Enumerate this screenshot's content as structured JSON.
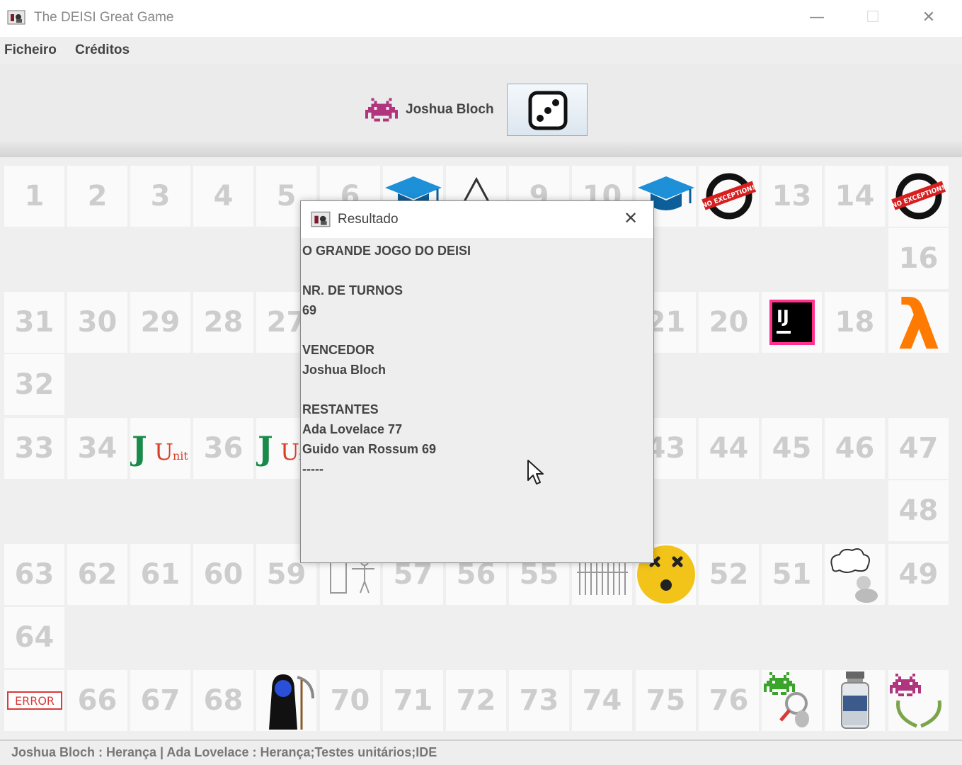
{
  "window": {
    "title": "The DEISI Great Game",
    "minimize_glyph": "—",
    "maximize_glyph": "☐",
    "close_glyph": "✕"
  },
  "menu": {
    "items": [
      "Ficheiro",
      "Créditos"
    ]
  },
  "current_player": {
    "name": "Joshua Bloch",
    "icon": "purple-space-invader-icon"
  },
  "dice_button": {
    "icon": "dice-icon",
    "face_value": 3
  },
  "board": {
    "cells": [
      {
        "num": "1"
      },
      {
        "num": "2"
      },
      {
        "num": "3"
      },
      {
        "num": "4"
      },
      {
        "num": "5"
      },
      {
        "num": "6"
      },
      {
        "icon": "graduation-cap-icon"
      },
      {
        "icon": "warning-triangle-icon"
      },
      {
        "num": "9"
      },
      {
        "num": "10"
      },
      {
        "icon": "graduation-cap-icon"
      },
      {
        "icon": "no-exceptions-icon"
      },
      {
        "num": "13"
      },
      {
        "num": "14"
      },
      {
        "icon": "no-exceptions-icon"
      },
      {
        "num": "16"
      },
      {
        "num": "31"
      },
      {
        "num": "30"
      },
      {
        "num": "29"
      },
      {
        "num": "28"
      },
      {
        "num": "27"
      },
      {
        "num": "21"
      },
      {
        "num": "20"
      },
      {
        "icon": "intellij-icon"
      },
      {
        "num": "18"
      },
      {
        "icon": "lambda-icon"
      },
      {
        "num": "32"
      },
      {
        "num": "33"
      },
      {
        "num": "34"
      },
      {
        "icon": "junit-icon"
      },
      {
        "num": "36"
      },
      {
        "icon": "junit-icon"
      },
      {
        "num": "43"
      },
      {
        "num": "44"
      },
      {
        "num": "45"
      },
      {
        "num": "46"
      },
      {
        "num": "47"
      },
      {
        "num": "48"
      },
      {
        "num": "63"
      },
      {
        "num": "62"
      },
      {
        "num": "61"
      },
      {
        "num": "60"
      },
      {
        "num": "59"
      },
      {
        "icon": "crash-figure-icon"
      },
      {
        "num": "57"
      },
      {
        "num": "56"
      },
      {
        "num": "55"
      },
      {
        "icon": "cage-bars-icon"
      },
      {
        "icon": "dead-emoji-icon"
      },
      {
        "num": "52"
      },
      {
        "num": "51"
      },
      {
        "icon": "thinking-person-icon"
      },
      {
        "num": "49"
      },
      {
        "num": "64"
      },
      {
        "icon": "error-stamp-icon"
      },
      {
        "num": "66"
      },
      {
        "num": "67"
      },
      {
        "num": "68"
      },
      {
        "icon": "blue-reaper-icon"
      },
      {
        "num": "70"
      },
      {
        "num": "71"
      },
      {
        "num": "72"
      },
      {
        "num": "73"
      },
      {
        "num": "74"
      },
      {
        "num": "75"
      },
      {
        "num": "76"
      },
      {
        "icon": "green-invader-magnifier-icon"
      },
      {
        "icon": "vaccine-vial-icon"
      },
      {
        "icon": "purple-invader-laurel-icon"
      }
    ]
  },
  "error_stamp_text": "ERROR",
  "no_exceptions_text": "NO EXCEPTIONS",
  "intellij_text": "IJ",
  "junit_text": "JUnit",
  "dialog": {
    "title": "Resultado",
    "close_glyph": "✕",
    "lines": [
      "O GRANDE JOGO DO DEISI",
      "",
      "NR. DE TURNOS",
      "69",
      "",
      "VENCEDOR",
      "Joshua Bloch",
      "",
      "RESTANTES",
      "Ada Lovelace 77",
      "Guido van Rossum 69",
      "-----"
    ]
  },
  "status_bar": {
    "text": "Joshua Bloch : Herança | Ada Lovelace : Herança;Testes unitários;IDE"
  },
  "colors": {
    "cell_number": "#cdcdcd",
    "cap_blue": "#1e90d8",
    "lambda_orange": "#ff7a00",
    "invader_purple": "#b0357e",
    "invader_green": "#3aa52a",
    "reaper_blue": "#2a4fd8",
    "emoji_yellow": "#f2c318"
  }
}
